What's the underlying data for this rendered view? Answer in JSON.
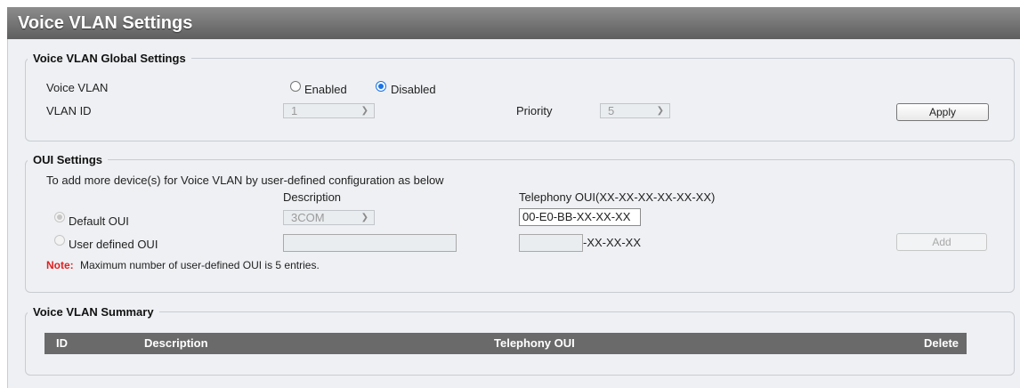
{
  "page_title": "Voice VLAN Settings",
  "global": {
    "legend": "Voice VLAN Global Settings",
    "voice_vlan_label": "Voice VLAN",
    "enabled_label": "Enabled",
    "disabled_label": "Disabled",
    "selected_state": "Disabled",
    "vlan_id_label": "VLAN ID",
    "vlan_id_value": "1",
    "priority_label": "Priority",
    "priority_value": "5",
    "apply_label": "Apply"
  },
  "oui": {
    "legend": "OUI Settings",
    "intro": "To add more device(s) for Voice VLAN by user-defined configuration as below",
    "description_header": "Description",
    "telephony_header": "Telephony OUI(XX-XX-XX-XX-XX-XX)",
    "default_oui_label": "Default OUI",
    "default_description": "3COM",
    "default_telephony": "00-E0-BB-XX-XX-XX",
    "user_defined_label": "User defined OUI",
    "user_description": "",
    "user_telephony": "",
    "user_suffix": "-XX-XX-XX",
    "add_label": "Add",
    "note_label": "Note:",
    "note_text": "Maximum number of user-defined OUI is 5 entries."
  },
  "summary": {
    "legend": "Voice VLAN Summary",
    "columns": [
      "ID",
      "Description",
      "Telephony OUI",
      "Delete"
    ]
  },
  "colors": {
    "accent": "#1a73e8",
    "note": "#e02020",
    "table_header": "#6a6a6a"
  }
}
